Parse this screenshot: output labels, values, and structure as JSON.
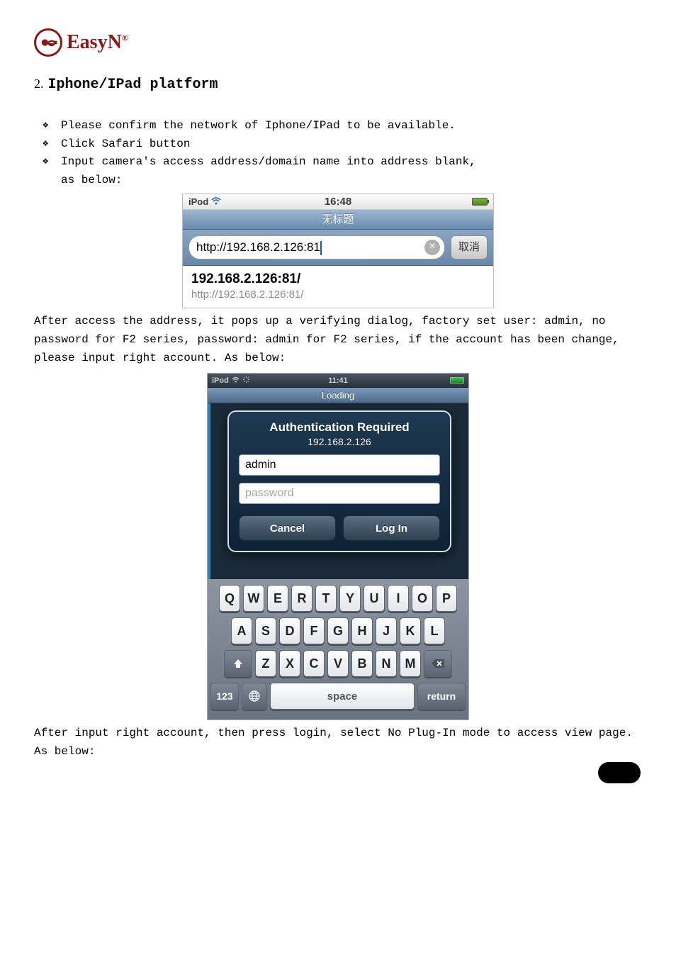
{
  "logo": {
    "text": "EasyN",
    "reg": "®"
  },
  "section": {
    "number": "2.",
    "title": "Iphone/IPad platform"
  },
  "bullets": {
    "b1": " Please confirm the network of Iphone/IPad to be available.",
    "b2": " Click Safari button",
    "b3": " Input camera's access address/domain name into address blank,",
    "b3b": "as below:"
  },
  "shot1": {
    "device": "iPod",
    "time": "16:48",
    "page_title": "无标题",
    "url": "http://192.168.2.126:81",
    "cancel": "取消",
    "suggest_main": "192.168.2.126:81/",
    "suggest_sub": "http://192.168.2.126:81/"
  },
  "para1": "After access the address, it pops up a verifying dialog, factory set user: admin, no password for F2 series, password: admin for F2 series, if the account has been change, please input right account. As below:",
  "shot2": {
    "device": "iPod",
    "time": "11:41",
    "loading": "Loading",
    "dlg_title": "Authentication Required",
    "dlg_host": "192.168.2.126",
    "user_value": "admin",
    "pass_placeholder": "password",
    "btn_cancel": "Cancel",
    "btn_login": "Log In",
    "keys_row1": [
      "Q",
      "W",
      "E",
      "R",
      "T",
      "Y",
      "U",
      "I",
      "O",
      "P"
    ],
    "keys_row2": [
      "A",
      "S",
      "D",
      "F",
      "G",
      "H",
      "J",
      "K",
      "L"
    ],
    "keys_row3": [
      "Z",
      "X",
      "C",
      "V",
      "B",
      "N",
      "M"
    ],
    "key_num": "123",
    "key_space": "space",
    "key_return": "return"
  },
  "para2": "After input right account, then press login, select No Plug-In mode to access view page. As below:"
}
